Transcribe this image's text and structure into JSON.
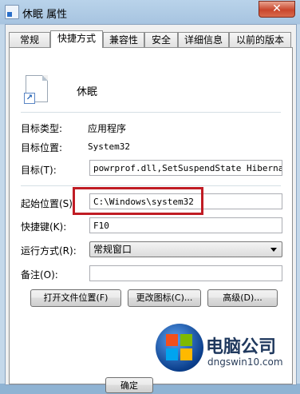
{
  "window": {
    "title": "休眠 属性",
    "close_label": "✕"
  },
  "tabs": [
    {
      "label": "常规",
      "active": false
    },
    {
      "label": "快捷方式",
      "active": true
    },
    {
      "label": "兼容性",
      "active": false
    },
    {
      "label": "安全",
      "active": false
    },
    {
      "label": "详细信息",
      "active": false
    },
    {
      "label": "以前的版本",
      "active": false
    }
  ],
  "shortcut": {
    "name": "休眠",
    "target_type_label": "目标类型:",
    "target_type_value": "应用程序",
    "target_location_label": "目标位置:",
    "target_location_value": "System32",
    "target_label": "目标(T):",
    "target_value": "powrprof.dll,SetSuspendState Hibernate",
    "start_in_label": "起始位置(S):",
    "start_in_value": "C:\\Windows\\system32",
    "hotkey_label": "快捷键(K):",
    "hotkey_value": "F10",
    "run_label": "运行方式(R):",
    "run_value": "常规窗口",
    "comment_label": "备注(O):",
    "comment_value": ""
  },
  "buttons": {
    "open_location": "打开文件位置(F)",
    "change_icon": "更改图标(C)...",
    "advanced": "高级(D)...",
    "ok": "确定"
  },
  "watermark": {
    "brand": "电脑公司",
    "url": "dngswin10.com"
  },
  "colors": {
    "highlight": "#c01c24",
    "accent": "#2a6fc9"
  }
}
